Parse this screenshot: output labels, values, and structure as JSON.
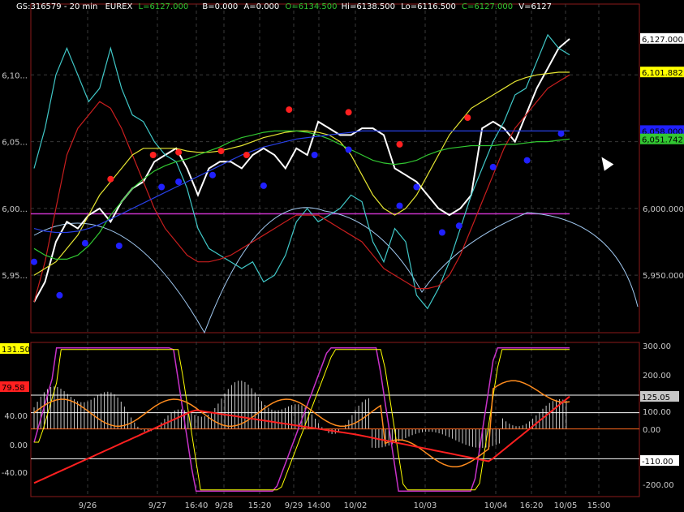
{
  "header": {
    "symbol": "GS:316579 - 20 min",
    "exchange": "EUREX",
    "last": "L=6127.000",
    "bid": "B=0.000",
    "ask": "A=0.000",
    "open": "O=6134.500",
    "high": "Hi=6138.500",
    "low": "Lo=6116.500",
    "close": "C=6127.000",
    "volume": "V=6127"
  },
  "colors": {
    "background": "#000000",
    "grid": "#3a3a3a",
    "frame": "#8b1a1a",
    "price": "#ffffff",
    "cyan": "#40c8c8",
    "red": "#c81e1e",
    "yellow": "#e6e632",
    "green": "#32c832",
    "blue": "#2840e6",
    "magenta": "#c832c8",
    "lightblue": "#a0c8f0",
    "dotRed": "#ff2020",
    "dotBlue": "#2020ff",
    "orange": "#ff8c1e",
    "osc_red": "#ff2020",
    "osc_yellow": "#ffff00",
    "hist": "#c8c8c8"
  },
  "chart_data": [
    {
      "type": "line",
      "title": "GS:316579 - 20 min",
      "ylim": [
        5910,
        6150
      ],
      "left_ticks": [
        "6,10...",
        "6,05...",
        "6,00...",
        "5,95..."
      ],
      "left_tick_values": [
        6100,
        6050,
        6000,
        5950
      ],
      "right_ticks": [
        "6,000.000",
        "5,950.000"
      ],
      "right_tick_values": [
        6000,
        5950
      ],
      "right_badges": [
        {
          "label": "6,127.000",
          "value": 6127,
          "color": "#ffffff",
          "text_color": "#000000"
        },
        {
          "label": "6,101.882",
          "value": 6101.882,
          "color": "#ffff00",
          "text_color": "#000000"
        },
        {
          "label": "6,058.000",
          "value": 6058,
          "color": "#2020ff",
          "text_color": "#2020ff"
        },
        {
          "label": "6,051.742",
          "value": 6051.742,
          "color": "#32c832",
          "text_color": "#000000"
        }
      ],
      "hline": 5996,
      "series": [
        {
          "key": "price",
          "values": [
            5930,
            5945,
            5975,
            5990,
            5985,
            5995,
            6000,
            5990,
            6005,
            6015,
            6020,
            6035,
            6040,
            6045,
            6030,
            6010,
            6030,
            6035,
            6035,
            6030,
            6040,
            6045,
            6040,
            6030,
            6045,
            6040,
            6065,
            6060,
            6055,
            6055,
            6060,
            6060,
            6055,
            6030,
            6025,
            6020,
            6010,
            6000,
            5995,
            6000,
            6010,
            6060,
            6065,
            6060,
            6050,
            6070,
            6090,
            6105,
            6120,
            6127
          ]
        },
        {
          "key": "cyan",
          "values": [
            6030,
            6060,
            6100,
            6120,
            6100,
            6080,
            6090,
            6120,
            6090,
            6070,
            6065,
            6050,
            6040,
            6035,
            6015,
            5985,
            5970,
            5965,
            5960,
            5955,
            5960,
            5945,
            5950,
            5965,
            5990,
            6000,
            5990,
            5995,
            6000,
            6010,
            6005,
            5975,
            5960,
            5985,
            5975,
            5935,
            5925,
            5940,
            5960,
            5985,
            6010,
            6030,
            6050,
            6065,
            6085,
            6090,
            6110,
            6130,
            6120,
            6115
          ]
        },
        {
          "key": "red",
          "values": [
            5930,
            5960,
            6000,
            6040,
            6060,
            6070,
            6080,
            6075,
            6060,
            6040,
            6020,
            6000,
            5985,
            5975,
            5965,
            5960,
            5960,
            5962,
            5965,
            5970,
            5975,
            5980,
            5985,
            5990,
            5995,
            5995,
            5995,
            5990,
            5985,
            5980,
            5975,
            5965,
            5955,
            5950,
            5945,
            5940,
            5940,
            5942,
            5950,
            5965,
            5985,
            6005,
            6025,
            6045,
            6060,
            6070,
            6080,
            6090,
            6095,
            6100
          ]
        },
        {
          "key": "yellow",
          "values": [
            5950,
            5955,
            5960,
            5970,
            5980,
            5995,
            6010,
            6020,
            6030,
            6040,
            6045,
            6045,
            6045,
            6045,
            6043,
            6042,
            6042,
            6043,
            6045,
            6047,
            6050,
            6053,
            6055,
            6057,
            6058,
            6058,
            6057,
            6055,
            6050,
            6040,
            6025,
            6010,
            6000,
            5995,
            6000,
            6010,
            6025,
            6040,
            6055,
            6065,
            6075,
            6080,
            6085,
            6090,
            6095,
            6098,
            6100,
            6101,
            6102,
            6102
          ]
        },
        {
          "key": "green",
          "values": [
            5970,
            5965,
            5962,
            5962,
            5965,
            5972,
            5982,
            5995,
            6005,
            6015,
            6022,
            6028,
            6032,
            6035,
            6037,
            6040,
            6043,
            6046,
            6050,
            6053,
            6055,
            6057,
            6058,
            6058,
            6058,
            6057,
            6055,
            6052,
            6048,
            6044,
            6040,
            6036,
            6034,
            6033,
            6034,
            6036,
            6040,
            6043,
            6045,
            6046,
            6047,
            6047,
            6047,
            6048,
            6048,
            6049,
            6050,
            6050,
            6051,
            6052
          ]
        },
        {
          "key": "blue",
          "values": [
            5985,
            5983,
            5982,
            5982,
            5983,
            5985,
            5988,
            5992,
            5996,
            6000,
            6004,
            6008,
            6012,
            6016,
            6020,
            6024,
            6028,
            6032,
            6036,
            6040,
            6043,
            6046,
            6048,
            6050,
            6052,
            6053,
            6054,
            6055,
            6056,
            6057,
            6058,
            6058,
            6058,
            6058,
            6058,
            6058,
            6058,
            6058,
            6058,
            6058,
            6058,
            6058,
            6058,
            6058,
            6058,
            6058,
            6058,
            6058,
            6058,
            6058
          ]
        }
      ],
      "dots_red": [
        [
          9,
          6022
        ],
        [
          14,
          6040
        ],
        [
          17,
          6042
        ],
        [
          22,
          6043
        ],
        [
          25,
          6040
        ],
        [
          30,
          6074
        ],
        [
          37,
          6072
        ],
        [
          43,
          6048
        ],
        [
          51,
          6068
        ]
      ],
      "dots_blue": [
        [
          0,
          5960
        ],
        [
          3,
          5935
        ],
        [
          6,
          5974
        ],
        [
          10,
          5972
        ],
        [
          15,
          6016
        ],
        [
          17,
          6020
        ],
        [
          21,
          6025
        ],
        [
          27,
          6017
        ],
        [
          33,
          6040
        ],
        [
          37,
          6044
        ],
        [
          43,
          6002
        ],
        [
          45,
          6016
        ],
        [
          48,
          5982
        ],
        [
          50,
          5987
        ],
        [
          54,
          6031
        ],
        [
          58,
          6036
        ],
        [
          62,
          6056
        ]
      ]
    },
    {
      "type": "line",
      "left_ticks": [
        "131.50",
        "79.58",
        "40.00",
        "0.00",
        "-40.00"
      ],
      "right_ticks": [
        "300.00",
        "200.00",
        "100.00",
        "0.00",
        "-110.00",
        "-200.00"
      ],
      "right_badges": [
        {
          "label": "125.05",
          "value": 125.05,
          "color": "#c8c8c8",
          "text_color": "#000000"
        },
        {
          "label": "-110.00",
          "value": -110,
          "color": "#ffffff",
          "text_color": "#000000"
        }
      ],
      "left_badges": [
        {
          "label": "131.50",
          "value": 131.5,
          "color": "#ffff00",
          "text_color": "#000000"
        },
        {
          "label": "79.58",
          "value": 79.58,
          "color": "#ff2020",
          "text_color": "#ff2020"
        }
      ],
      "hlines": [
        125,
        60,
        0,
        -110
      ],
      "ylim": [
        -250,
        320
      ]
    }
  ],
  "x_labels": [
    "9/26",
    "9/27",
    "16:40",
    "9/28",
    "15:20",
    "9/29",
    "14:00",
    "10/02",
    "10/03",
    "10/04",
    "16:20",
    "10/05",
    "15:00"
  ]
}
